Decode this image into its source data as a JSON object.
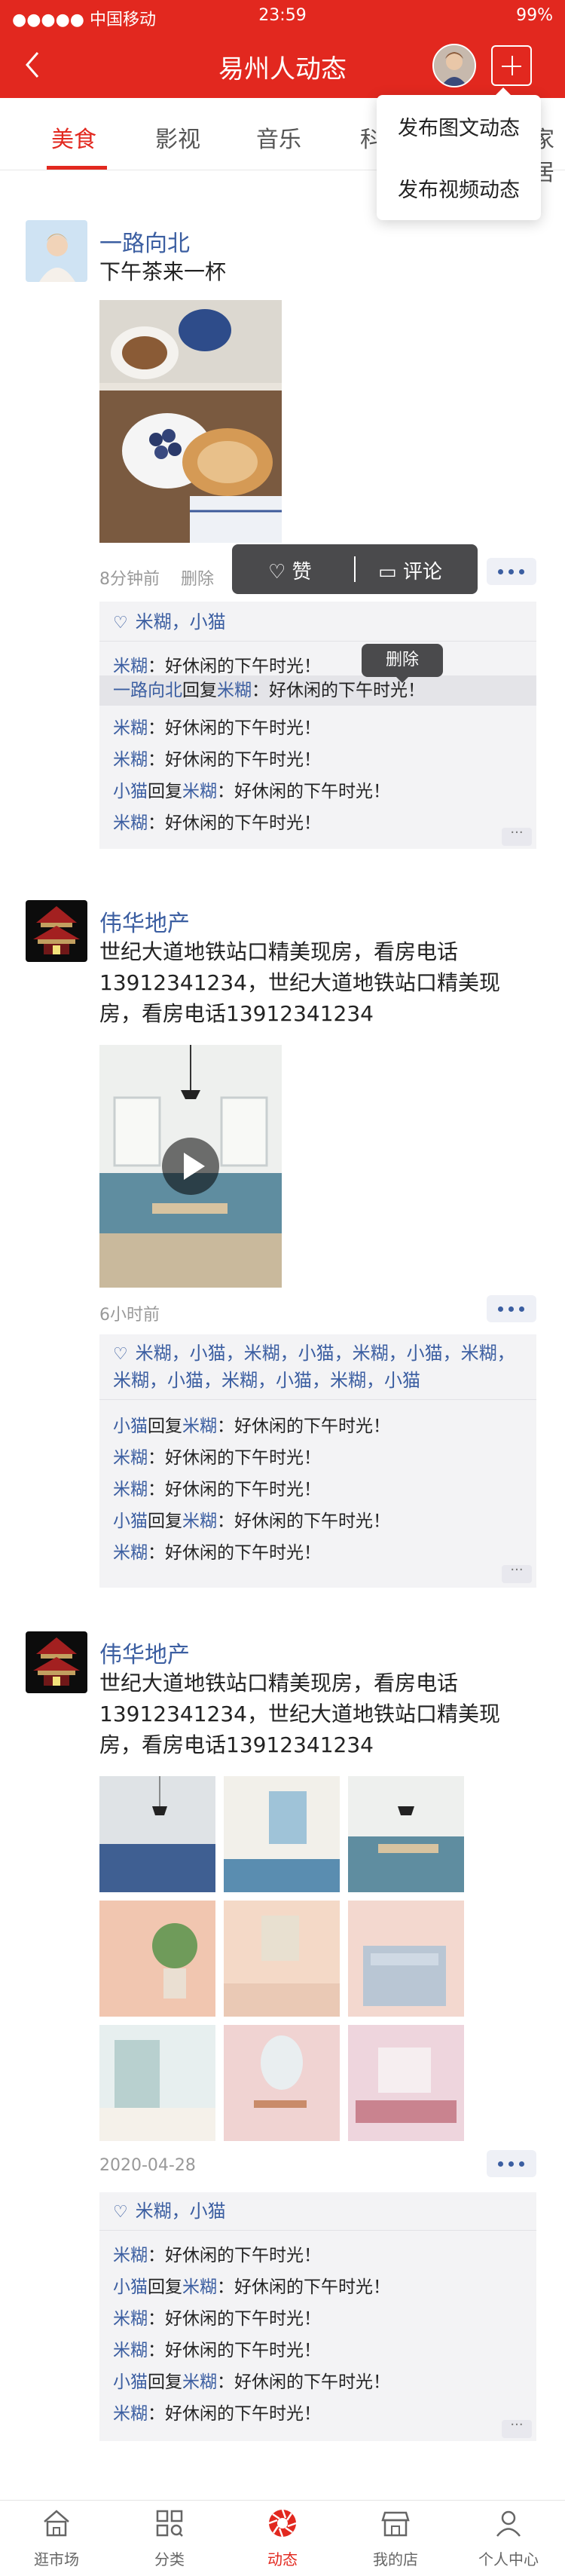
{
  "status_bar": {
    "carrier": "●●●●● 中国移动",
    "time": "23:59",
    "battery": "99%"
  },
  "header": {
    "title": "易州人动态"
  },
  "tabs": [
    {
      "label": "美食"
    },
    {
      "label": "影视"
    },
    {
      "label": "音乐"
    },
    {
      "label": "科"
    },
    {
      "label": "家居"
    }
  ],
  "publish_menu": {
    "items": [
      {
        "label": "发布图文动态"
      },
      {
        "label": "发布视频动态"
      }
    ]
  },
  "action_bar": {
    "like": "赞",
    "comment": "评论"
  },
  "delete_tooltip": "删除",
  "posts": [
    {
      "author": "一路向北",
      "text": "下午茶来一杯",
      "time": "8分钟前",
      "delete": "删除",
      "likes": "米糊，小猫",
      "comments": [
        {
          "user": "米糊",
          "reply_to": "",
          "content": "好休闲的下午时光！"
        },
        {
          "user": "一路向北",
          "reply_to": "米糊",
          "content": "好休闲的下午时光！"
        },
        {
          "user": "米糊",
          "reply_to": "",
          "content": "好休闲的下午时光！"
        },
        {
          "user": "米糊",
          "reply_to": "",
          "content": "好休闲的下午时光！"
        },
        {
          "user": "小猫",
          "reply_to": "米糊",
          "content": "好休闲的下午时光！"
        },
        {
          "user": "米糊",
          "reply_to": "",
          "content": "好休闲的下午时光！"
        }
      ],
      "comments_more": "···"
    },
    {
      "author": "伟华地产",
      "text": "世纪大道地铁站口精美现房，看房电话13912341234，世纪大道地铁站口精美现房，看房电话13912341234",
      "time": "6小时前",
      "likes": "米糊，小猫，米糊，小猫，米糊，小猫，米糊，米糊，小猫，米糊，小猫，米糊，小猫",
      "comments": [
        {
          "user": "小猫",
          "reply_to": "米糊",
          "content": "好休闲的下午时光！"
        },
        {
          "user": "米糊",
          "reply_to": "",
          "content": "好休闲的下午时光！"
        },
        {
          "user": "米糊",
          "reply_to": "",
          "content": "好休闲的下午时光！"
        },
        {
          "user": "小猫",
          "reply_to": "米糊",
          "content": "好休闲的下午时光！"
        },
        {
          "user": "米糊",
          "reply_to": "",
          "content": "好休闲的下午时光！"
        }
      ],
      "comments_more": "···"
    },
    {
      "author": "伟华地产",
      "text": "世纪大道地铁站口精美现房，看房电话13912341234，世纪大道地铁站口精美现房，看房电话13912341234",
      "time": "2020-04-28",
      "likes": "米糊，小猫",
      "comments": [
        {
          "user": "米糊",
          "reply_to": "",
          "content": "好休闲的下午时光！"
        },
        {
          "user": "小猫",
          "reply_to": "米糊",
          "content": "好休闲的下午时光！"
        },
        {
          "user": "米糊",
          "reply_to": "",
          "content": "好休闲的下午时光！"
        },
        {
          "user": "米糊",
          "reply_to": "",
          "content": "好休闲的下午时光！"
        },
        {
          "user": "小猫",
          "reply_to": "米糊",
          "content": "好休闲的下午时光！"
        },
        {
          "user": "米糊",
          "reply_to": "",
          "content": "好休闲的下午时光！"
        }
      ],
      "comments_more": "···"
    }
  ],
  "reply_word": "回复",
  "colon": "：",
  "tabbar": [
    {
      "label": "逛市场",
      "icon": "shop-icon"
    },
    {
      "label": "分类",
      "icon": "category-icon"
    },
    {
      "label": "动态",
      "icon": "camera-shutter-icon"
    },
    {
      "label": "我的店",
      "icon": "store-icon"
    },
    {
      "label": "个人中心",
      "icon": "person-icon"
    }
  ],
  "colors": {
    "brand": "#e2281f",
    "link": "#3b5ea1"
  }
}
